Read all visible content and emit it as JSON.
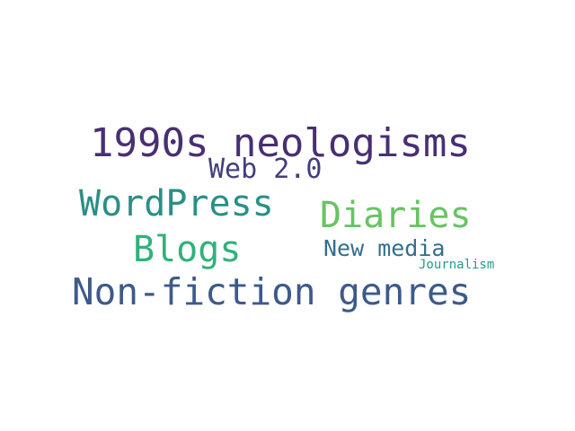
{
  "words": [
    {
      "text": "1990s neologisms",
      "color": "#482f73"
    },
    {
      "text": "Web 2.0",
      "color": "#433e7d"
    },
    {
      "text": "WordPress",
      "color": "#2a8f86"
    },
    {
      "text": "Diaries",
      "color": "#67c463"
    },
    {
      "text": "Blogs",
      "color": "#2fb27b"
    },
    {
      "text": "New media",
      "color": "#346e8d"
    },
    {
      "text": "Journalism",
      "color": "#299a8c"
    },
    {
      "text": "Non-fiction genres",
      "color": "#3d5a8b"
    }
  ]
}
